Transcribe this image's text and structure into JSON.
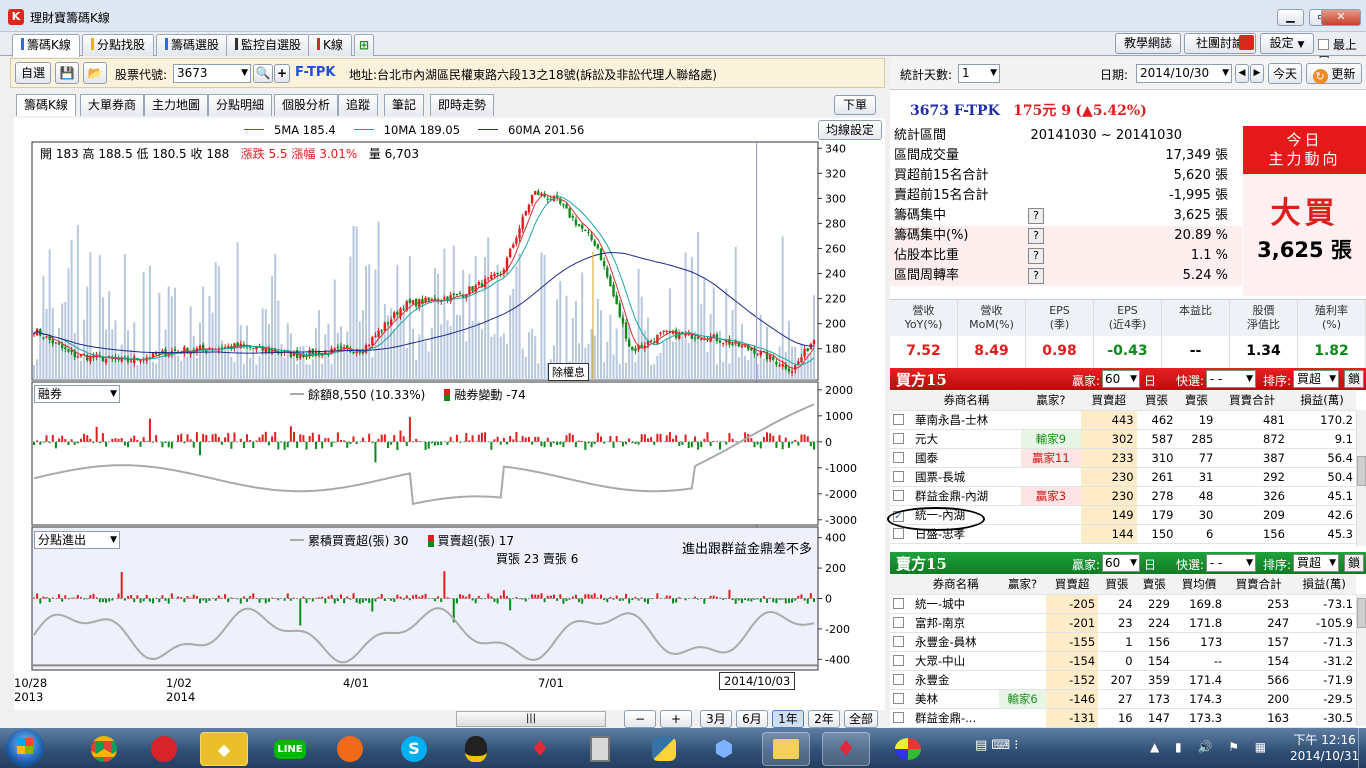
{
  "window": {
    "title": "理財寶籌碼K線",
    "app_icon": "K"
  },
  "main_tabs": [
    {
      "label": "籌碼K線",
      "color": "#2b6fd6"
    },
    {
      "label": "分點找股",
      "color": "#e8b800"
    },
    {
      "label": "籌碼選股",
      "color": "#2b6fd6"
    },
    {
      "label": "監控自選股",
      "color": "#333333"
    },
    {
      "label": "K線",
      "color": "#d9291c"
    }
  ],
  "top_buttons": {
    "tutorial": "教學網誌",
    "forum": "社團討論",
    "settings": "設定",
    "topmost": "最上層"
  },
  "toolbar": {
    "selfpick": "自選",
    "code_label": "股票代號:",
    "code_value": "3673",
    "stock_name": "F-TPK",
    "address": "地址:台北市內湖區民權東路六段13之18號(訴訟及非訟代理人聯絡處)"
  },
  "sub_tabs": [
    "籌碼K線",
    "大單券商",
    "主力地圖",
    "分點明細",
    "個股分析",
    "追蹤",
    "筆記",
    "即時走勢"
  ],
  "buttons": {
    "order": "下單",
    "ma_settings": "均線設定",
    "dividend": "除權息",
    "zoom_out": "−",
    "zoom_in": "+",
    "ranges": [
      "3月",
      "6月",
      "1年",
      "2年",
      "全部"
    ]
  },
  "price_chart": {
    "ma_legend": [
      "5MA 185.4",
      "10MA 189.05",
      "60MA 201.56"
    ],
    "ohlc": "開 183  高 188.5  低 180.5  收 188",
    "change": "漲跌 5.5  漲幅  3.01%",
    "volume": "量 6,703"
  },
  "mid_panel": {
    "select": "融券",
    "legend1": "餘額8,550 (10.33%)",
    "legend2": "融券變動 -74"
  },
  "bot_panel": {
    "select": "分點進出",
    "legend1": "累積買賣超(張) 30",
    "legend2": "買賣超(張) 17",
    "legend3": "買張 23  賣張 6",
    "annotation": "進出跟群益金鼎差不多"
  },
  "x_axis": {
    "labels": [
      "10/28",
      "1/02",
      "4/01",
      "7/01"
    ],
    "years": [
      "2013",
      "2014"
    ],
    "cursor_date": "2014/10/03"
  },
  "chart_data": [
    {
      "type": "candlestick",
      "title": "",
      "yticks": [
        180,
        200,
        220,
        240,
        260,
        280,
        300,
        320,
        340
      ],
      "ylim": [
        155,
        345
      ],
      "series": [
        {
          "name": "5MA",
          "color": "#d43030"
        },
        {
          "name": "10MA",
          "color": "#1aa6a6"
        },
        {
          "name": "60MA",
          "color": "#1c2a8c"
        }
      ],
      "close_trend": [
        {
          "x": "2013/10/28",
          "y": 195
        },
        {
          "x": "2013/11/15",
          "y": 175
        },
        {
          "x": "2013/12/10",
          "y": 170
        },
        {
          "x": "2014/01/02",
          "y": 178
        },
        {
          "x": "2014/02/01",
          "y": 182
        },
        {
          "x": "2014/03/01",
          "y": 175
        },
        {
          "x": "2014/04/01",
          "y": 180
        },
        {
          "x": "2014/04/20",
          "y": 215
        },
        {
          "x": "2014/05/15",
          "y": 222
        },
        {
          "x": "2014/06/05",
          "y": 240
        },
        {
          "x": "2014/06/20",
          "y": 305
        },
        {
          "x": "2014/07/01",
          "y": 298
        },
        {
          "x": "2014/07/20",
          "y": 262
        },
        {
          "x": "2014/08/05",
          "y": 178
        },
        {
          "x": "2014/08/20",
          "y": 192
        },
        {
          "x": "2014/09/10",
          "y": 190
        },
        {
          "x": "2014/10/03",
          "y": 178
        },
        {
          "x": "2014/10/20",
          "y": 163
        },
        {
          "x": "2014/10/30",
          "y": 188
        }
      ]
    },
    {
      "type": "bar",
      "title": "",
      "yticks": [
        2000,
        1000,
        0,
        -1000,
        -2000,
        -3000
      ],
      "ylim": [
        -3200,
        2300
      ]
    },
    {
      "type": "bar",
      "title": "",
      "yticks": [
        400,
        200,
        0,
        -200,
        -400
      ],
      "ylim": [
        -470,
        470
      ]
    }
  ],
  "right": {
    "days_label": "統計天數:",
    "days_value": "1",
    "date_label": "日期:",
    "date_value": "2014/10/30",
    "today": "今天",
    "refresh": "更新",
    "stock_line": "3673 F-TPK",
    "price": "175元 9",
    "change": "(▲5.42%)",
    "stats": [
      [
        "統計區間",
        "20141030 ~ 20141030"
      ],
      [
        "區間成交量",
        "17,349 張"
      ],
      [
        "買超前15名合計",
        "5,620 張"
      ],
      [
        "賣超前15名合計",
        "-1,995 張"
      ],
      [
        "籌碼集中",
        "3,625 張"
      ],
      [
        "籌碼集中(%)",
        "20.89 %"
      ],
      [
        "佔股本比重",
        "1.1 %"
      ],
      [
        "區間周轉率",
        "5.24 %"
      ]
    ],
    "today_title1": "今日",
    "today_title2": "主力動向",
    "today_action": "大買",
    "today_qty": "3,625 張",
    "fund_headers": [
      "營收\nYoY(%)",
      "營收\nMoM(%)",
      "EPS\n(季)",
      "EPS\n(近4季)",
      "本益比",
      "股價\n淨值比",
      "殖利率\n(%)"
    ],
    "fund_values": [
      "7.52",
      "8.49",
      "0.98",
      "-0.43",
      "--",
      "1.34",
      "1.82"
    ],
    "buy_title": "買方15",
    "sell_title": "賣方15",
    "winner_label": "贏家:",
    "winner_value": "60",
    "day_unit": "日",
    "quick_label": "快選:",
    "quick_value": "- -",
    "sort_label": "排序:",
    "sort_value": "買超",
    "lock": "鎖",
    "buy_headers": [
      "券商名稱",
      "贏家?",
      "買賣超",
      "買張",
      "賣張",
      "買賣合計",
      "損益(萬)"
    ],
    "buy_rows": [
      [
        "華南永昌-士林",
        "",
        "443",
        "462",
        "19",
        "481",
        "170.2"
      ],
      [
        "元大",
        "輸家9",
        "302",
        "587",
        "285",
        "872",
        "9.1"
      ],
      [
        "國泰",
        "贏家11",
        "233",
        "310",
        "77",
        "387",
        "56.4"
      ],
      [
        "國票-長城",
        "",
        "230",
        "261",
        "31",
        "292",
        "50.4"
      ],
      [
        "群益金鼎-內湖",
        "贏家3",
        "230",
        "278",
        "48",
        "326",
        "45.1"
      ],
      [
        "統一-內湖",
        "",
        "149",
        "179",
        "30",
        "209",
        "42.6"
      ],
      [
        "日盛-忠孝",
        "",
        "144",
        "150",
        "6",
        "156",
        "45.3"
      ]
    ],
    "sell_headers": [
      "券商名稱",
      "贏家?",
      "買賣超",
      "買張",
      "賣張",
      "買均價",
      "買賣合計",
      "損益(萬)"
    ],
    "sell_rows": [
      [
        "統一-城中",
        "",
        "-205",
        "24",
        "229",
        "169.8",
        "253",
        "-73.1"
      ],
      [
        "富邦-南京",
        "",
        "-201",
        "23",
        "224",
        "171.8",
        "247",
        "-105.9"
      ],
      [
        "永豐金-員林",
        "",
        "-155",
        "1",
        "156",
        "173",
        "157",
        "-71.3"
      ],
      [
        "大眾-中山",
        "",
        "-154",
        "0",
        "154",
        "--",
        "154",
        "-31.2"
      ],
      [
        "永豐金",
        "",
        "-152",
        "207",
        "359",
        "171.4",
        "566",
        "-71.9"
      ],
      [
        "美林",
        "輸家6",
        "-146",
        "27",
        "173",
        "174.3",
        "200",
        "-29.5"
      ],
      [
        "群益金鼎-...",
        "",
        "-131",
        "16",
        "147",
        "173.3",
        "163",
        "-30.5"
      ]
    ]
  },
  "taskbar": {
    "time": "下午 12:16",
    "date": "2014/10/31"
  }
}
